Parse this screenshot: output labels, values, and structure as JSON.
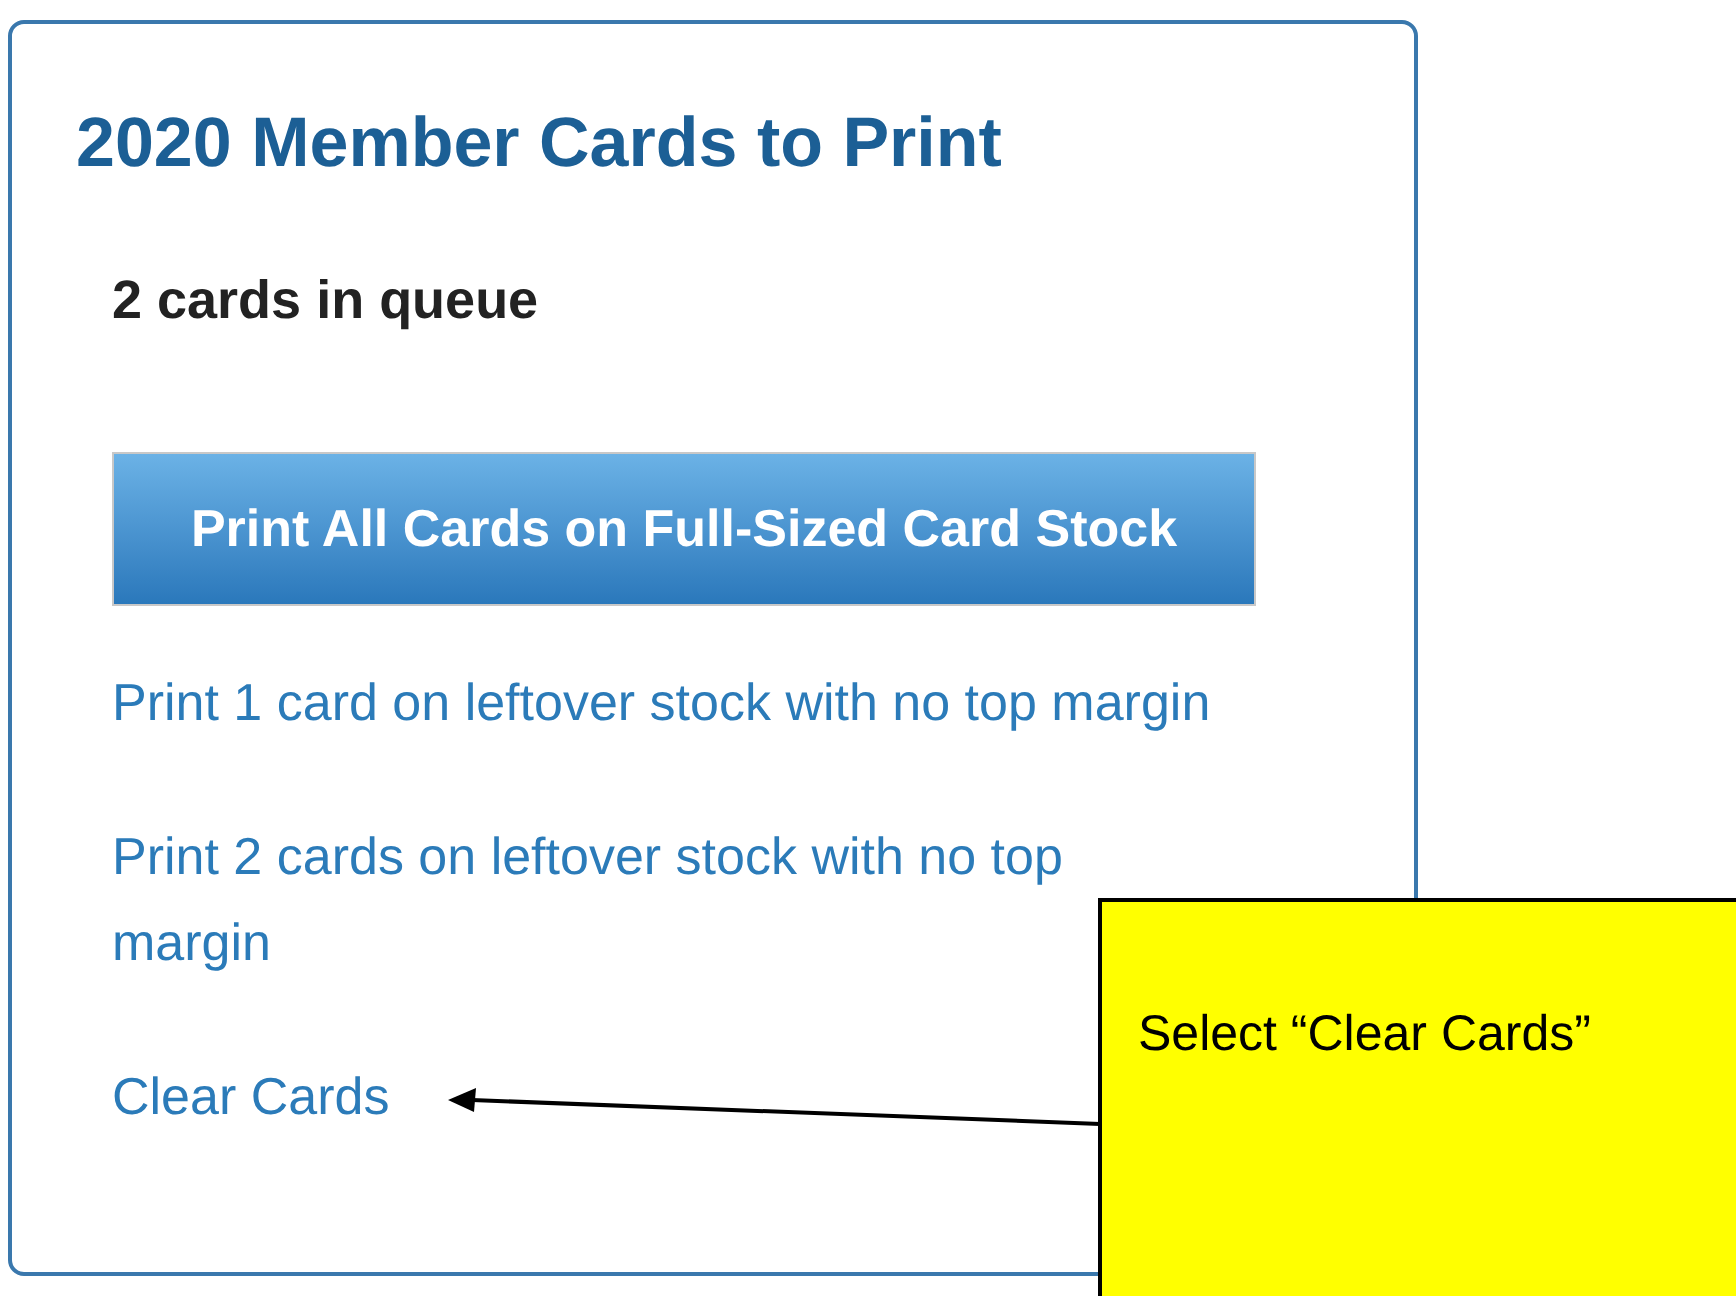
{
  "card": {
    "title": "2020 Member Cards to Print",
    "queue_count": "2 cards in queue",
    "primary_button": "Print All Cards on Full-Sized Card Stock",
    "links": [
      "Print 1 card on leftover stock with no top margin",
      "Print 2 cards on leftover stock with no top margin",
      "Clear Cards"
    ]
  },
  "callout": {
    "text": "Select “Clear Cards”"
  }
}
